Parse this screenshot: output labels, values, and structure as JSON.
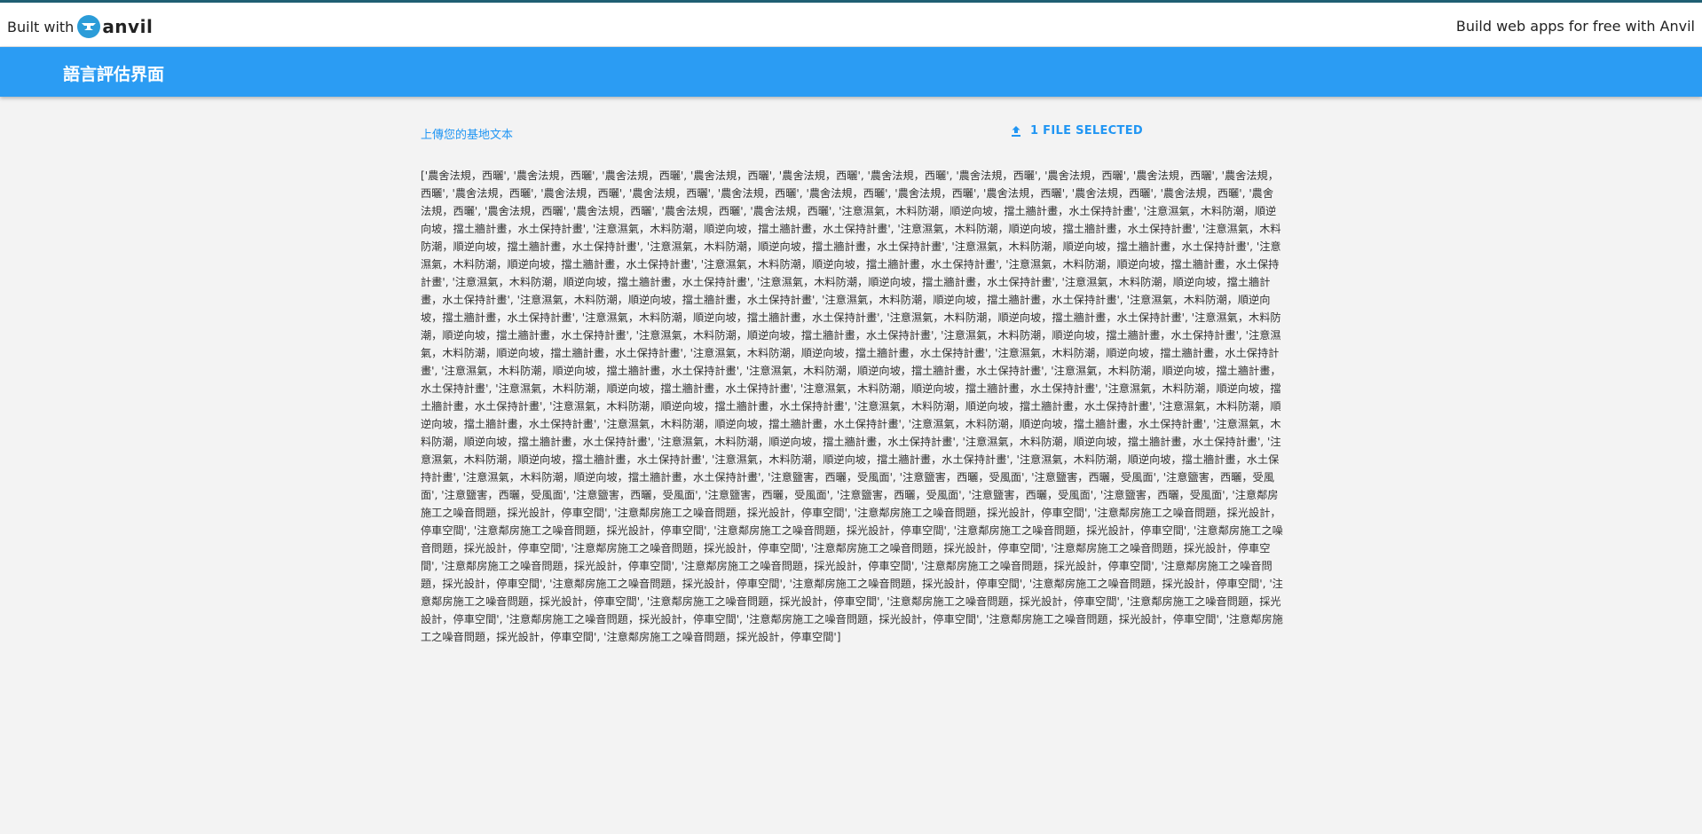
{
  "anvil_banner": {
    "built_with": "Built with",
    "logo_icon": "anvil-logo-icon",
    "logo_wordmark": "anvil",
    "promo": "Build web apps for free with Anvil"
  },
  "header": {
    "title": "語言評估界面"
  },
  "upload": {
    "label": "上傳您的基地文本",
    "file_loader": "1 FILE SELECTED",
    "icon": "upload-icon"
  },
  "output": {
    "text": "['農舍法規，西曬', '農舍法規，西曬', '農舍法規，西曬', '農舍法規，西曬', '農舍法規，西曬', '農舍法規，西曬', '農舍法規，西曬', '農舍法規，西曬', '農舍法規，西曬', '農舍法規，西曬', '農舍法規，西曬', '農舍法規，西曬', '農舍法規，西曬', '農舍法規，西曬', '農舍法規，西曬', '農舍法規，西曬', '農舍法規，西曬', '農舍法規，西曬', '農舍法規，西曬', '農舍法規，西曬', '農舍法規，西曬', '農舍法規，西曬', '農舍法規，西曬', '農舍法規，西曬', '注意濕氣，木料防潮，順逆向坡，擋土牆計畫，水土保持計畫', '注意濕氣，木料防潮，順逆向坡，擋土牆計畫，水土保持計畫', '注意濕氣，木料防潮，順逆向坡，擋土牆計畫，水土保持計畫', '注意濕氣，木料防潮，順逆向坡，擋土牆計畫，水土保持計畫', '注意濕氣，木料防潮，順逆向坡，擋土牆計畫，水土保持計畫', '注意濕氣，木料防潮，順逆向坡，擋土牆計畫，水土保持計畫', '注意濕氣，木料防潮，順逆向坡，擋土牆計畫，水土保持計畫', '注意濕氣，木料防潮，順逆向坡，擋土牆計畫，水土保持計畫', '注意濕氣，木料防潮，順逆向坡，擋土牆計畫，水土保持計畫', '注意濕氣，木料防潮，順逆向坡，擋土牆計畫，水土保持計畫', '注意濕氣，木料防潮，順逆向坡，擋土牆計畫，水土保持計畫', '注意濕氣，木料防潮，順逆向坡，擋土牆計畫，水土保持計畫', '注意濕氣，木料防潮，順逆向坡，擋土牆計畫，水土保持計畫', '注意濕氣，木料防潮，順逆向坡，擋土牆計畫，水土保持計畫', '注意濕氣，木料防潮，順逆向坡，擋土牆計畫，水土保持計畫', '注意濕氣，木料防潮，順逆向坡，擋土牆計畫，水土保持計畫', '注意濕氣，木料防潮，順逆向坡，擋土牆計畫，水土保持計畫', '注意濕氣，木料防潮，順逆向坡，擋土牆計畫，水土保持計畫', '注意濕氣，木料防潮，順逆向坡，擋土牆計畫，水土保持計畫', '注意濕氣，木料防潮，順逆向坡，擋土牆計畫，水土保持計畫', '注意濕氣，木料防潮，順逆向坡，擋土牆計畫，水土保持計畫', '注意濕氣，木料防潮，順逆向坡，擋土牆計畫，水土保持計畫', '注意濕氣，木料防潮，順逆向坡，擋土牆計畫，水土保持計畫', '注意濕氣，木料防潮，順逆向坡，擋土牆計畫，水土保持計畫', '注意濕氣，木料防潮，順逆向坡，擋土牆計畫，水土保持計畫', '注意濕氣，木料防潮，順逆向坡，擋土牆計畫，水土保持計畫', '注意濕氣，木料防潮，順逆向坡，擋土牆計畫，水土保持計畫', '注意濕氣，木料防潮，順逆向坡，擋土牆計畫，水土保持計畫', '注意濕氣，木料防潮，順逆向坡，擋土牆計畫，水土保持計畫', '注意濕氣，木料防潮，順逆向坡，擋土牆計畫，水土保持計畫', '注意濕氣，木料防潮，順逆向坡，擋土牆計畫，水土保持計畫', '注意濕氣，木料防潮，順逆向坡，擋土牆計畫，水土保持計畫', '注意濕氣，木料防潮，順逆向坡，擋土牆計畫，水土保持計畫', '注意濕氣，木料防潮，順逆向坡，擋土牆計畫，水土保持計畫', '注意濕氣，木料防潮，順逆向坡，擋土牆計畫，水土保持計畫', '注意濕氣，木料防潮，順逆向坡，擋土牆計畫，水土保持計畫', '注意濕氣，木料防潮，順逆向坡，擋土牆計畫，水土保持計畫', '注意濕氣，木料防潮，順逆向坡，擋土牆計畫，水土保持計畫', '注意濕氣，木料防潮，順逆向坡，擋土牆計畫，水土保持計畫', '注意濕氣，木料防潮，順逆向坡，擋土牆計畫，水土保持計畫', '注意濕氣，木料防潮，順逆向坡，擋土牆計畫，水土保持計畫', '注意濕氣，木料防潮，順逆向坡，擋土牆計畫，水土保持計畫', '注意鹽害，西曬，受風面', '注意鹽害，西曬，受風面', '注意鹽害，西曬，受風面', '注意鹽害，西曬，受風面', '注意鹽害，西曬，受風面', '注意鹽害，西曬，受風面', '注意鹽害，西曬，受風面', '注意鹽害，西曬，受風面', '注意鹽害，西曬，受風面', '注意鹽害，西曬，受風面', '注意鄰房施工之噪音問題，採光設計，停車空間', '注意鄰房施工之噪音問題，採光設計，停車空間', '注意鄰房施工之噪音問題，採光設計，停車空間', '注意鄰房施工之噪音問題，採光設計，停車空間', '注意鄰房施工之噪音問題，採光設計，停車空間', '注意鄰房施工之噪音問題，採光設計，停車空間', '注意鄰房施工之噪音問題，採光設計，停車空間', '注意鄰房施工之噪音問題，採光設計，停車空間', '注意鄰房施工之噪音問題，採光設計，停車空間', '注意鄰房施工之噪音問題，採光設計，停車空間', '注意鄰房施工之噪音問題，採光設計，停車空間', '注意鄰房施工之噪音問題，採光設計，停車空間', '注意鄰房施工之噪音問題，採光設計，停車空間', '注意鄰房施工之噪音問題，採光設計，停車空間', '注意鄰房施工之噪音問題，採光設計，停車空間', '注意鄰房施工之噪音問題，採光設計，停車空間', '注意鄰房施工之噪音問題，採光設計，停車空間', '注意鄰房施工之噪音問題，採光設計，停車空間', '注意鄰房施工之噪音問題，採光設計，停車空間', '注意鄰房施工之噪音問題，採光設計，停車空間', '注意鄰房施工之噪音問題，採光設計，停車空間', '注意鄰房施工之噪音問題，採光設計，停車空間', '注意鄰房施工之噪音問題，採光設計，停車空間', '注意鄰房施工之噪音問題，採光設計，停車空間', '注意鄰房施工之噪音問題，採光設計，停車空間', '注意鄰房施工之噪音問題，採光設計，停車空間', '注意鄰房施工之噪音問題，採光設計，停車空間']"
  },
  "colors": {
    "banner_accent": "#1f5f73",
    "header_bg": "#2b9cf3",
    "link_blue": "#2196f3",
    "page_bg": "#f3f3f3",
    "text": "#333333"
  }
}
